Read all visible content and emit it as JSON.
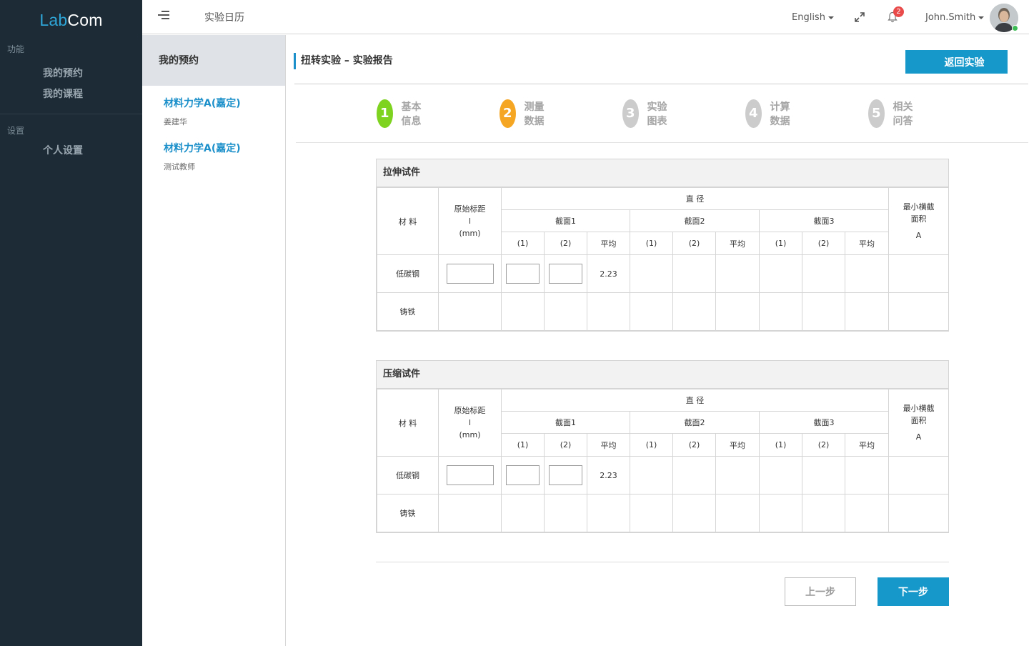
{
  "sidebar": {
    "logo_part1": "Lab",
    "logo_part2": "Com",
    "section_features": "功能",
    "items": [
      {
        "label": "我的预约"
      },
      {
        "label": "我的课程"
      }
    ],
    "section_settings": "设置",
    "settings_items": [
      {
        "label": "个人设置"
      }
    ]
  },
  "topbar": {
    "menu_icon": "menu-toggle-icon",
    "title": "实验日历",
    "language": "English",
    "notifications_count": "2",
    "username": "John.Smith",
    "status_color": "#3dbb55"
  },
  "subnav": {
    "header": "我的预约",
    "courses": [
      {
        "name": "材料力学A(嘉定)",
        "teacher": "姜建华"
      },
      {
        "name": "材料力学A(嘉定)",
        "teacher": "测试教师"
      }
    ]
  },
  "main": {
    "title": "扭转实验 – 实验报告",
    "back_button": "返回实验",
    "steps": [
      {
        "num": "1",
        "label": "基本信息",
        "color": "#7ed321"
      },
      {
        "num": "2",
        "label": "测量数据",
        "color": "#f5a623"
      },
      {
        "num": "3",
        "label": "实验图表",
        "color": "#cccccc"
      },
      {
        "num": "4",
        "label": "计算数据",
        "color": "#cccccc"
      },
      {
        "num": "5",
        "label": "相关问答",
        "color": "#cccccc"
      }
    ],
    "table_headers": {
      "material": "材  料",
      "gauge_line1": "原始标距",
      "gauge_line2": "l",
      "gauge_line3": "(mm)",
      "diameter": "直  径",
      "section1": "截面1",
      "section2": "截面2",
      "section3": "截面3",
      "m1": "(1)",
      "m2": "(2)",
      "avg": "平均",
      "area_line1": "最小横截",
      "area_line2": "面积",
      "area_line3": "A"
    },
    "tables": [
      {
        "title": "拉伸试件",
        "rows": [
          {
            "material": "低碳钢",
            "avg1": "2.23"
          },
          {
            "material": "铸铁"
          }
        ]
      },
      {
        "title": "压缩试件",
        "rows": [
          {
            "material": "低碳钢",
            "avg1": "2.23"
          },
          {
            "material": "铸铁"
          }
        ]
      }
    ],
    "prev_button": "上一步",
    "next_button": "下一步",
    "accent_color": "#1698cb"
  }
}
